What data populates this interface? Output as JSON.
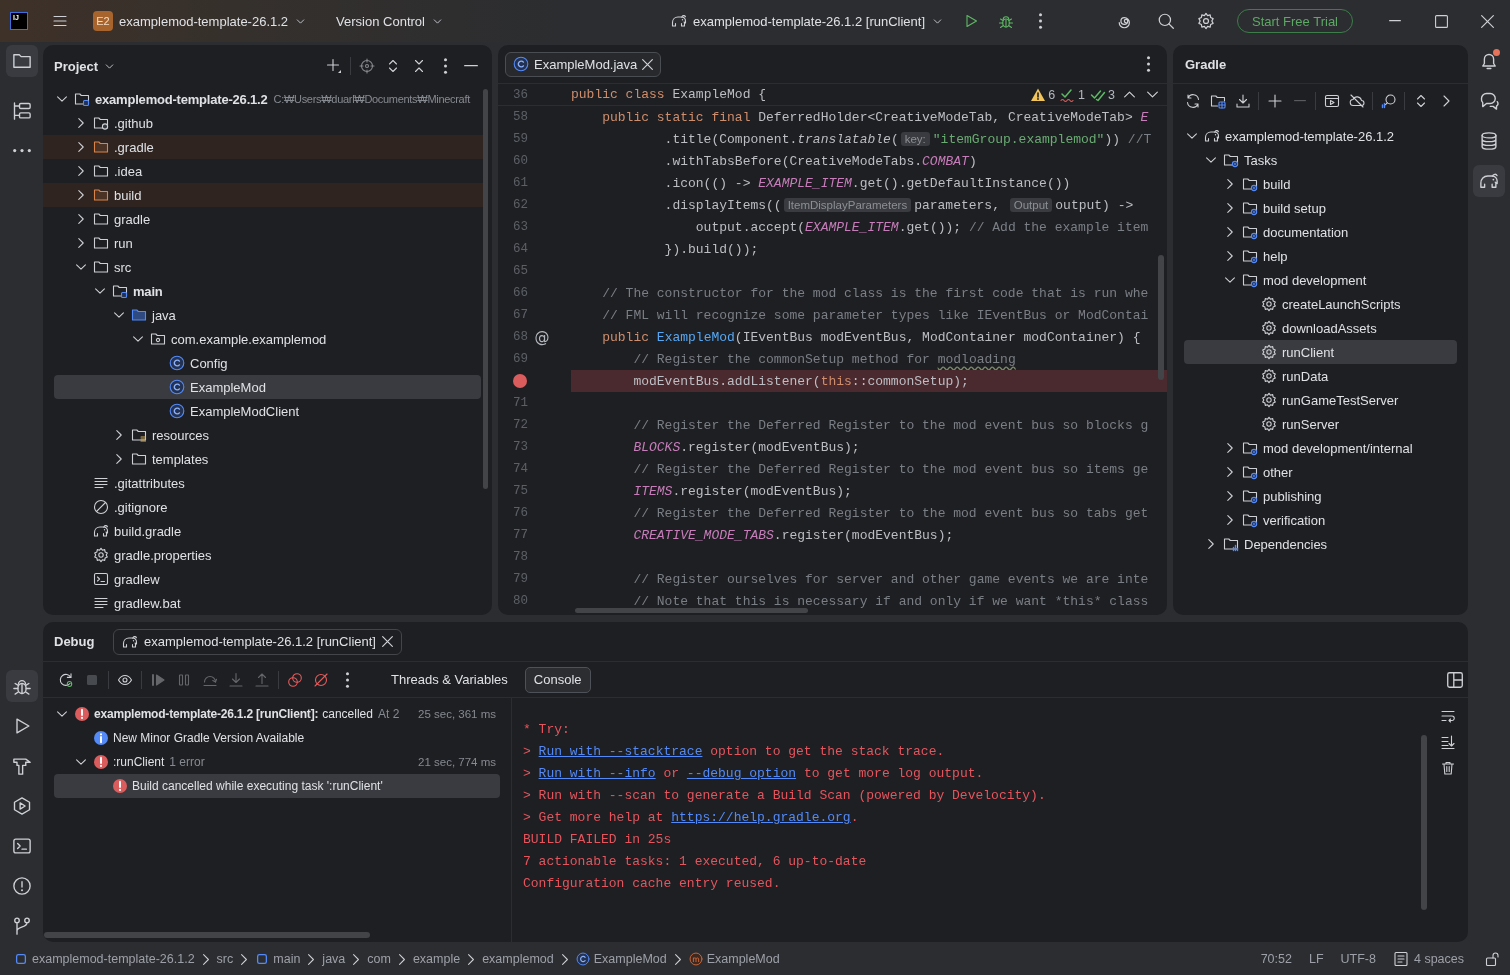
{
  "title_bar": {
    "app_logo": "IJ",
    "project": {
      "badge": "E2",
      "name": "examplemod-template-26.1.2"
    },
    "vcs_menu": "Version Control",
    "run_config": "examplemod-template-26.1.2 [runClient]",
    "trial_button": "Start Free Trial"
  },
  "left_strip": {
    "top": [
      {
        "kind": "project",
        "selected": true
      },
      {
        "kind": "structure",
        "selected": false
      },
      {
        "kind": "more",
        "selected": false
      }
    ],
    "bottom": [
      {
        "kind": "debug",
        "selected": true
      },
      {
        "kind": "run",
        "selected": false
      },
      {
        "kind": "build",
        "selected": false
      },
      {
        "kind": "services",
        "selected": false
      },
      {
        "kind": "terminal",
        "selected": false
      },
      {
        "kind": "problems",
        "selected": false
      },
      {
        "kind": "git",
        "selected": false
      }
    ]
  },
  "project": {
    "title": "Project",
    "tree": [
      {
        "name": "examplemod-template-26.1.2",
        "path": "C:₩Users₩duarl₩Documents₩Minecraft",
        "kind": "module",
        "expanded": true,
        "selected": false,
        "children": [
          {
            "name": ".github",
            "kind": "github",
            "expanded": false,
            "selected": false
          },
          {
            "name": ".gradle",
            "kind": "excluded",
            "expanded": false,
            "selected": false
          },
          {
            "name": ".idea",
            "kind": "folder",
            "expanded": false,
            "selected": false
          },
          {
            "name": "build",
            "kind": "excluded",
            "expanded": false,
            "selected": false
          },
          {
            "name": "gradle",
            "kind": "folder",
            "expanded": false,
            "selected": false
          },
          {
            "name": "run",
            "kind": "folder",
            "expanded": false,
            "selected": false
          },
          {
            "name": "src",
            "kind": "folder",
            "expanded": true,
            "selected": false,
            "children": [
              {
                "name": "main",
                "kind": "module",
                "expanded": true,
                "selected": false,
                "children": [
                  {
                    "name": "java",
                    "kind": "source",
                    "expanded": true,
                    "selected": false,
                    "children": [
                      {
                        "name": "com.example.examplemod",
                        "kind": "package",
                        "expanded": true,
                        "selected": false,
                        "children": [
                          {
                            "name": "Config",
                            "kind": "class",
                            "selected": false
                          },
                          {
                            "name": "ExampleMod",
                            "kind": "class",
                            "selected": true
                          },
                          {
                            "name": "ExampleModClient",
                            "kind": "class",
                            "selected": false
                          }
                        ]
                      }
                    ]
                  },
                  {
                    "name": "resources",
                    "kind": "resources",
                    "expanded": false,
                    "selected": false
                  },
                  {
                    "name": "templates",
                    "kind": "folder",
                    "expanded": false,
                    "selected": false
                  }
                ]
              }
            ]
          },
          {
            "name": ".gitattributes",
            "kind": "text",
            "selected": false
          },
          {
            "name": ".gitignore",
            "kind": "ignore",
            "selected": false
          },
          {
            "name": "build.gradle",
            "kind": "gradle",
            "selected": false
          },
          {
            "name": "gradle.properties",
            "kind": "properties",
            "selected": false
          },
          {
            "name": "gradlew",
            "kind": "script",
            "selected": false
          },
          {
            "name": "gradlew.bat",
            "kind": "text",
            "selected": false
          }
        ]
      }
    ]
  },
  "editor": {
    "tabs": [
      {
        "label": "ExampleMod.java",
        "selected": true
      }
    ],
    "inspections": [
      {
        "kind": "warning",
        "count": "6"
      },
      {
        "kind": "typo",
        "count": "1"
      },
      {
        "kind": "ok",
        "count": "3"
      }
    ],
    "sticky": {
      "number": "36",
      "tokens": [
        {
          "kind": "keyword",
          "text": "public class "
        },
        {
          "kind": "plain",
          "text": "ExampleMod {"
        }
      ]
    },
    "lines": [
      {
        "number": "58",
        "breakpoint": false,
        "tokens": [
          {
            "kind": "keyword",
            "text": "    public static final "
          },
          {
            "kind": "plain",
            "text": "DeferredHolder<CreativeModeTab, CreativeModeTab> "
          },
          {
            "kind": "static",
            "text": "E"
          }
        ]
      },
      {
        "number": "59",
        "breakpoint": false,
        "tokens": [
          {
            "kind": "plain",
            "text": "            .title(Component."
          },
          {
            "kind": "italic",
            "text": "translatable"
          },
          {
            "kind": "plain",
            "text": "("
          },
          {
            "kind": "hint",
            "text": "key:"
          },
          {
            "kind": "string",
            "text": "\"itemGroup.examplemod\""
          },
          {
            "kind": "plain",
            "text": "))"
          },
          {
            "kind": "comment",
            "text": " //T"
          }
        ]
      },
      {
        "number": "60",
        "breakpoint": false,
        "tokens": [
          {
            "kind": "plain",
            "text": "            .withTabsBefore(CreativeModeTabs."
          },
          {
            "kind": "static",
            "text": "COMBAT"
          },
          {
            "kind": "plain",
            "text": ")"
          }
        ]
      },
      {
        "number": "61",
        "breakpoint": false,
        "tokens": [
          {
            "kind": "plain",
            "text": "            .icon(() -> "
          },
          {
            "kind": "static",
            "text": "EXAMPLE_ITEM"
          },
          {
            "kind": "plain",
            "text": ".get().getDefaultInstance())"
          }
        ]
      },
      {
        "number": "62",
        "breakpoint": false,
        "tokens": [
          {
            "kind": "plain",
            "text": "            .displayItems(("
          },
          {
            "kind": "hint",
            "text": "ItemDisplayParameters"
          },
          {
            "kind": "plain",
            "text": "parameters, "
          },
          {
            "kind": "hint",
            "text": "Output"
          },
          {
            "kind": "plain",
            "text": "output) ->"
          }
        ]
      },
      {
        "number": "63",
        "breakpoint": false,
        "tokens": [
          {
            "kind": "plain",
            "text": "                output.accept("
          },
          {
            "kind": "static",
            "text": "EXAMPLE_ITEM"
          },
          {
            "kind": "plain",
            "text": ".get()); "
          },
          {
            "kind": "comment",
            "text": "// Add the example item"
          }
        ]
      },
      {
        "number": "64",
        "breakpoint": false,
        "tokens": [
          {
            "kind": "plain",
            "text": "            }).build());"
          }
        ]
      },
      {
        "number": "65",
        "breakpoint": false
      },
      {
        "number": "66",
        "breakpoint": false,
        "tokens": [
          {
            "kind": "comment",
            "text": "    // The constructor for the mod class is the first code that is run whe"
          }
        ]
      },
      {
        "number": "67",
        "breakpoint": false,
        "tokens": [
          {
            "kind": "comment",
            "text": "    // FML will recognize some parameter types like IEventBus or ModContai"
          }
        ]
      },
      {
        "number": "68",
        "breakpoint": false,
        "gutter": "@",
        "tokens": [
          {
            "kind": "keyword",
            "text": "    public "
          },
          {
            "kind": "declaration",
            "text": "ExampleMod"
          },
          {
            "kind": "plain",
            "text": "(IEventBus modEventBus, ModContainer modContainer) {"
          }
        ]
      },
      {
        "number": "69",
        "breakpoint": false,
        "tokens": [
          {
            "kind": "comment",
            "text": "        // Register the commonSetup method for "
          },
          {
            "kind": "typo",
            "text": "modloading"
          }
        ]
      },
      {
        "breakpoint": true,
        "tokens": [
          {
            "kind": "plain",
            "text": "        modEventBus.addListener("
          },
          {
            "kind": "keyword",
            "text": "this"
          },
          {
            "kind": "plain",
            "text": "::commonSetup);"
          }
        ]
      },
      {
        "number": "71",
        "breakpoint": false
      },
      {
        "number": "72",
        "breakpoint": false,
        "tokens": [
          {
            "kind": "comment",
            "text": "        // Register the Deferred Register to the mod event bus so blocks g"
          }
        ]
      },
      {
        "number": "73",
        "breakpoint": false,
        "tokens": [
          {
            "kind": "static",
            "text": "        BLOCKS"
          },
          {
            "kind": "plain",
            "text": ".register(modEventBus);"
          }
        ]
      },
      {
        "number": "74",
        "breakpoint": false,
        "tokens": [
          {
            "kind": "comment",
            "text": "        // Register the Deferred Register to the mod event bus so items ge"
          }
        ]
      },
      {
        "number": "75",
        "breakpoint": false,
        "tokens": [
          {
            "kind": "static",
            "text": "        ITEMS"
          },
          {
            "kind": "plain",
            "text": ".register(modEventBus);"
          }
        ]
      },
      {
        "number": "76",
        "breakpoint": false,
        "tokens": [
          {
            "kind": "comment",
            "text": "        // Register the Deferred Register to the mod event bus so tabs get"
          }
        ]
      },
      {
        "number": "77",
        "breakpoint": false,
        "tokens": [
          {
            "kind": "static",
            "text": "        CREATIVE_MODE_TABS"
          },
          {
            "kind": "plain",
            "text": ".register(modEventBus);"
          }
        ]
      },
      {
        "number": "78",
        "breakpoint": false
      },
      {
        "number": "79",
        "breakpoint": false,
        "tokens": [
          {
            "kind": "comment",
            "text": "        // Register ourselves for server and other game events we are inte"
          }
        ]
      },
      {
        "number": "80",
        "breakpoint": false,
        "tokens": [
          {
            "kind": "comment",
            "text": "        // Note that this is necessary if and only if we want *this* class"
          }
        ]
      }
    ]
  },
  "gradle": {
    "title": "Gradle",
    "toolbar": [
      {
        "buttons": [
          {
            "kind": "reload",
            "disabled": false
          },
          {
            "kind": "attach",
            "disabled": false
          },
          {
            "kind": "download",
            "disabled": false
          }
        ]
      },
      {
        "buttons": [
          {
            "kind": "add",
            "disabled": false
          },
          {
            "kind": "remove",
            "disabled": true
          }
        ]
      },
      {
        "buttons": [
          {
            "kind": "run-task",
            "disabled": false
          },
          {
            "kind": "offline",
            "disabled": false
          }
        ]
      },
      {
        "buttons": [
          {
            "kind": "analyze",
            "disabled": false
          }
        ]
      },
      {
        "buttons": [
          {
            "kind": "expand",
            "disabled": false
          },
          {
            "kind": "next",
            "disabled": false
          }
        ]
      }
    ],
    "tree": [
      {
        "name": "examplemod-template-26.1.2",
        "kind": "project",
        "expanded": true,
        "selected": false,
        "children": [
          {
            "name": "Tasks",
            "kind": "group",
            "expanded": true,
            "selected": false,
            "children": [
              {
                "name": "build",
                "kind": "group",
                "expanded": false,
                "selected": false
              },
              {
                "name": "build setup",
                "kind": "group",
                "expanded": false,
                "selected": false
              },
              {
                "name": "documentation",
                "kind": "group",
                "expanded": false,
                "selected": false
              },
              {
                "name": "help",
                "kind": "group",
                "expanded": false,
                "selected": false
              },
              {
                "name": "mod development",
                "kind": "group",
                "expanded": true,
                "selected": false,
                "children": [
                  {
                    "name": "createLaunchScripts",
                    "kind": "task",
                    "selected": false
                  },
                  {
                    "name": "downloadAssets",
                    "kind": "task",
                    "selected": false
                  },
                  {
                    "name": "runClient",
                    "kind": "task",
                    "selected": true
                  },
                  {
                    "name": "runData",
                    "kind": "task",
                    "selected": false
                  },
                  {
                    "name": "runGameTestServer",
                    "kind": "task",
                    "selected": false
                  },
                  {
                    "name": "runServer",
                    "kind": "task",
                    "selected": false
                  }
                ]
              },
              {
                "name": "mod development/internal",
                "kind": "group",
                "expanded": false,
                "selected": false
              },
              {
                "name": "other",
                "kind": "group",
                "expanded": false,
                "selected": false
              },
              {
                "name": "publishing",
                "kind": "group",
                "expanded": false,
                "selected": false
              },
              {
                "name": "verification",
                "kind": "group",
                "expanded": false,
                "selected": false
              }
            ]
          },
          {
            "name": "Dependencies",
            "kind": "dependencies",
            "expanded": false,
            "selected": false
          }
        ]
      }
    ]
  },
  "right_strip": [
    {
      "kind": "notifications",
      "selected": false,
      "unread": true
    },
    {
      "kind": "ai-chat",
      "selected": false,
      "unread": false
    },
    {
      "kind": "database",
      "selected": false,
      "unread": false
    },
    {
      "kind": "gradle",
      "selected": true,
      "unread": false
    }
  ],
  "debug": {
    "title": "Debug",
    "session_tab": "examplemod-template-26.1.2 [runClient]",
    "toolbar": [
      {
        "buttons": [
          {
            "kind": "rerun",
            "disabled": false
          },
          {
            "kind": "stop",
            "disabled": true
          }
        ]
      },
      {
        "buttons": [
          {
            "kind": "eye",
            "disabled": false
          }
        ]
      },
      {
        "buttons": [
          {
            "kind": "resume",
            "disabled": true
          },
          {
            "kind": "pause",
            "disabled": true
          },
          {
            "kind": "step-over",
            "disabled": true
          },
          {
            "kind": "step-into",
            "disabled": true
          },
          {
            "kind": "step-out",
            "disabled": true
          }
        ]
      },
      {
        "buttons": [
          {
            "kind": "breakpoints",
            "disabled": false
          },
          {
            "kind": "mute",
            "disabled": false
          },
          {
            "kind": "options",
            "disabled": false
          }
        ]
      }
    ],
    "view_tabs": [
      {
        "label": "Threads & Variables",
        "selected": false
      },
      {
        "label": "Console",
        "selected": true
      }
    ],
    "build_tree": [
      {
        "kind": "error",
        "title": "examplemod-template-26.1.2 [runClient]:",
        "status": "cancelled",
        "detail": "At 2",
        "duration": "25 sec, 361 ms",
        "expanded": true,
        "selected": false,
        "children": [
          {
            "kind": "info",
            "title": "New Minor Gradle Version Available",
            "selected": false
          },
          {
            "kind": "error",
            "title": ":runClient",
            "detail": "1 error",
            "duration": "21 sec, 774 ms",
            "expanded": true,
            "selected": false,
            "children": [
              {
                "kind": "error",
                "title": "Build cancelled while executing task ':runClient'",
                "selected": true
              }
            ]
          }
        ]
      }
    ],
    "console": [
      {
        "segments": [
          {
            "kind": "text",
            "text": "* Try:"
          }
        ]
      },
      {
        "segments": [
          {
            "kind": "text",
            "text": "> "
          },
          {
            "kind": "link",
            "text": "Run with --stacktrace"
          },
          {
            "kind": "text",
            "text": " option to get the stack trace."
          }
        ]
      },
      {
        "segments": [
          {
            "kind": "text",
            "text": "> "
          },
          {
            "kind": "link",
            "text": "Run with --info"
          },
          {
            "kind": "text",
            "text": " or "
          },
          {
            "kind": "link",
            "text": "--debug option"
          },
          {
            "kind": "text",
            "text": " to get more log output."
          }
        ]
      },
      {
        "segments": [
          {
            "kind": "text",
            "text": "> Run with --scan to generate a Build Scan (powered by Develocity)."
          }
        ]
      },
      {
        "segments": [
          {
            "kind": "text",
            "text": "> Get more help at "
          },
          {
            "kind": "link",
            "text": "https://help.gradle.org"
          },
          {
            "kind": "text",
            "text": "."
          }
        ]
      },
      {
        "segments": [
          {
            "kind": "text",
            "text": "BUILD FAILED in 25s"
          }
        ]
      },
      {
        "segments": [
          {
            "kind": "text",
            "text": "7 actionable tasks: 1 executed, 6 up-to-date"
          }
        ]
      },
      {
        "segments": [
          {
            "kind": "text",
            "text": "Configuration cache entry reused."
          }
        ]
      }
    ]
  },
  "status_bar": {
    "breadcrumbs": [
      {
        "kind": "module",
        "text": "examplemod-template-26.1.2"
      },
      {
        "kind": "plain",
        "text": "src"
      },
      {
        "kind": "module",
        "text": "main"
      },
      {
        "kind": "plain",
        "text": "java"
      },
      {
        "kind": "plain",
        "text": "com"
      },
      {
        "kind": "plain",
        "text": "example"
      },
      {
        "kind": "plain",
        "text": "examplemod"
      },
      {
        "kind": "class",
        "text": "ExampleMod"
      },
      {
        "kind": "method",
        "text": "ExampleMod"
      }
    ],
    "widgets": [
      {
        "kind": "plain",
        "text": "70:52"
      },
      {
        "kind": "plain",
        "text": "LF"
      },
      {
        "kind": "plain",
        "text": "UTF-8"
      },
      {
        "kind": "indent",
        "text": "4 spaces"
      }
    ]
  }
}
